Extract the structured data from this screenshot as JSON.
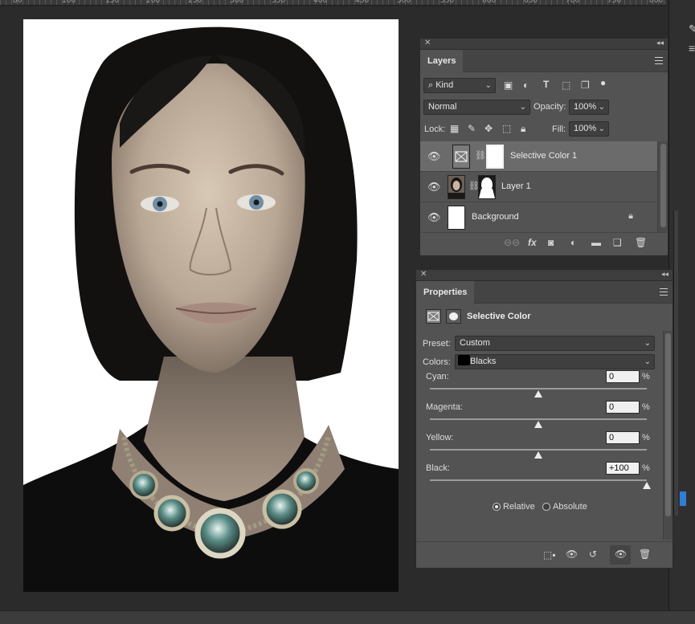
{
  "ruler": {
    "ticks": [
      "80",
      "100",
      "150",
      "200",
      "250",
      "300",
      "350",
      "400",
      "450",
      "500",
      "550",
      "600",
      "650",
      "700",
      "750",
      "800"
    ]
  },
  "layers_panel": {
    "tab": "Layers",
    "filter_kind": "Kind",
    "blend_mode": "Normal",
    "opacity_label": "Opacity:",
    "opacity_value": "100%",
    "lock_label": "Lock:",
    "fill_label": "Fill:",
    "fill_value": "100%",
    "layers": [
      {
        "name": "Selective Color 1",
        "selected": true
      },
      {
        "name": "Layer 1",
        "selected": false
      },
      {
        "name": "Background",
        "selected": false
      }
    ],
    "icons": [
      "image-filter-icon",
      "adjustment-filter-icon",
      "type-filter-icon",
      "shape-filter-icon",
      "smart-object-filter-icon",
      "filter-toggle-icon"
    ]
  },
  "properties_panel": {
    "tab": "Properties",
    "title": "Selective Color",
    "preset_label": "Preset:",
    "preset_value": "Custom",
    "colors_label": "Colors:",
    "colors_value": "Blacks",
    "colors_swatch": "#000000",
    "sliders": [
      {
        "label": "Cyan:",
        "value": "0",
        "level": 0
      },
      {
        "label": "Magenta:",
        "value": "0",
        "level": 0
      },
      {
        "label": "Yellow:",
        "value": "0",
        "level": 0
      },
      {
        "label": "Black:",
        "value": "+100",
        "level": 100
      }
    ],
    "percent": "%",
    "method_relative": "Relative",
    "method_absolute": "Absolute",
    "method_selected": "Relative"
  },
  "colors": {
    "panel_bg": "#535353",
    "selected_row": "#6b6b6b",
    "accent_blue": "#2f7dd6"
  }
}
